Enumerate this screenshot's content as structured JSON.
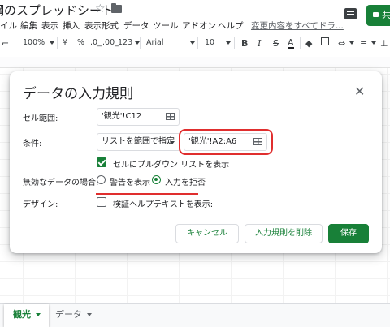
{
  "header": {
    "doc_title": "鋼のスプレッドシート",
    "share_label": "共"
  },
  "menu": {
    "items": [
      "イル",
      "編集",
      "表示",
      "挿入",
      "表示形式",
      "データ",
      "ツール",
      "アドオン",
      "ヘルプ"
    ],
    "save_status": "変更内容をすべてドラ..."
  },
  "toolbar": {
    "zoom": "100%",
    "currency": "¥",
    "percent": "%",
    "decimal_decrease": ".0_",
    "decimal_increase": ".00_",
    "number_format": "123",
    "font": "Arial",
    "font_size": "10",
    "bold": "B",
    "italic": "I",
    "strikethrough": "S",
    "text_color": "A"
  },
  "dialog": {
    "title": "データの入力規則",
    "cell_range_label": "セル範囲:",
    "cell_range_value": "'観光'!C12",
    "criteria_label": "条件:",
    "criteria_type": "リストを範囲で指定",
    "criteria_range": "'観光'!A2:A6",
    "show_dropdown_label": "セルにプルダウン リストを表示",
    "show_dropdown_checked": true,
    "invalid_label": "無効なデータの場合:",
    "invalid_options": [
      "警告を表示",
      "入力を拒否"
    ],
    "invalid_selected": "入力を拒否",
    "appearance_label": "デザイン:",
    "help_text_label": "検証ヘルプテキストを表示:",
    "help_text_checked": false,
    "cancel_label": "キャンセル",
    "remove_label": "入力規則を削除",
    "save_label": "保存"
  },
  "sheets": {
    "active": "観光",
    "other": "データ"
  },
  "colors": {
    "accent_green": "#188038",
    "highlight_red": "#e02e2e"
  }
}
